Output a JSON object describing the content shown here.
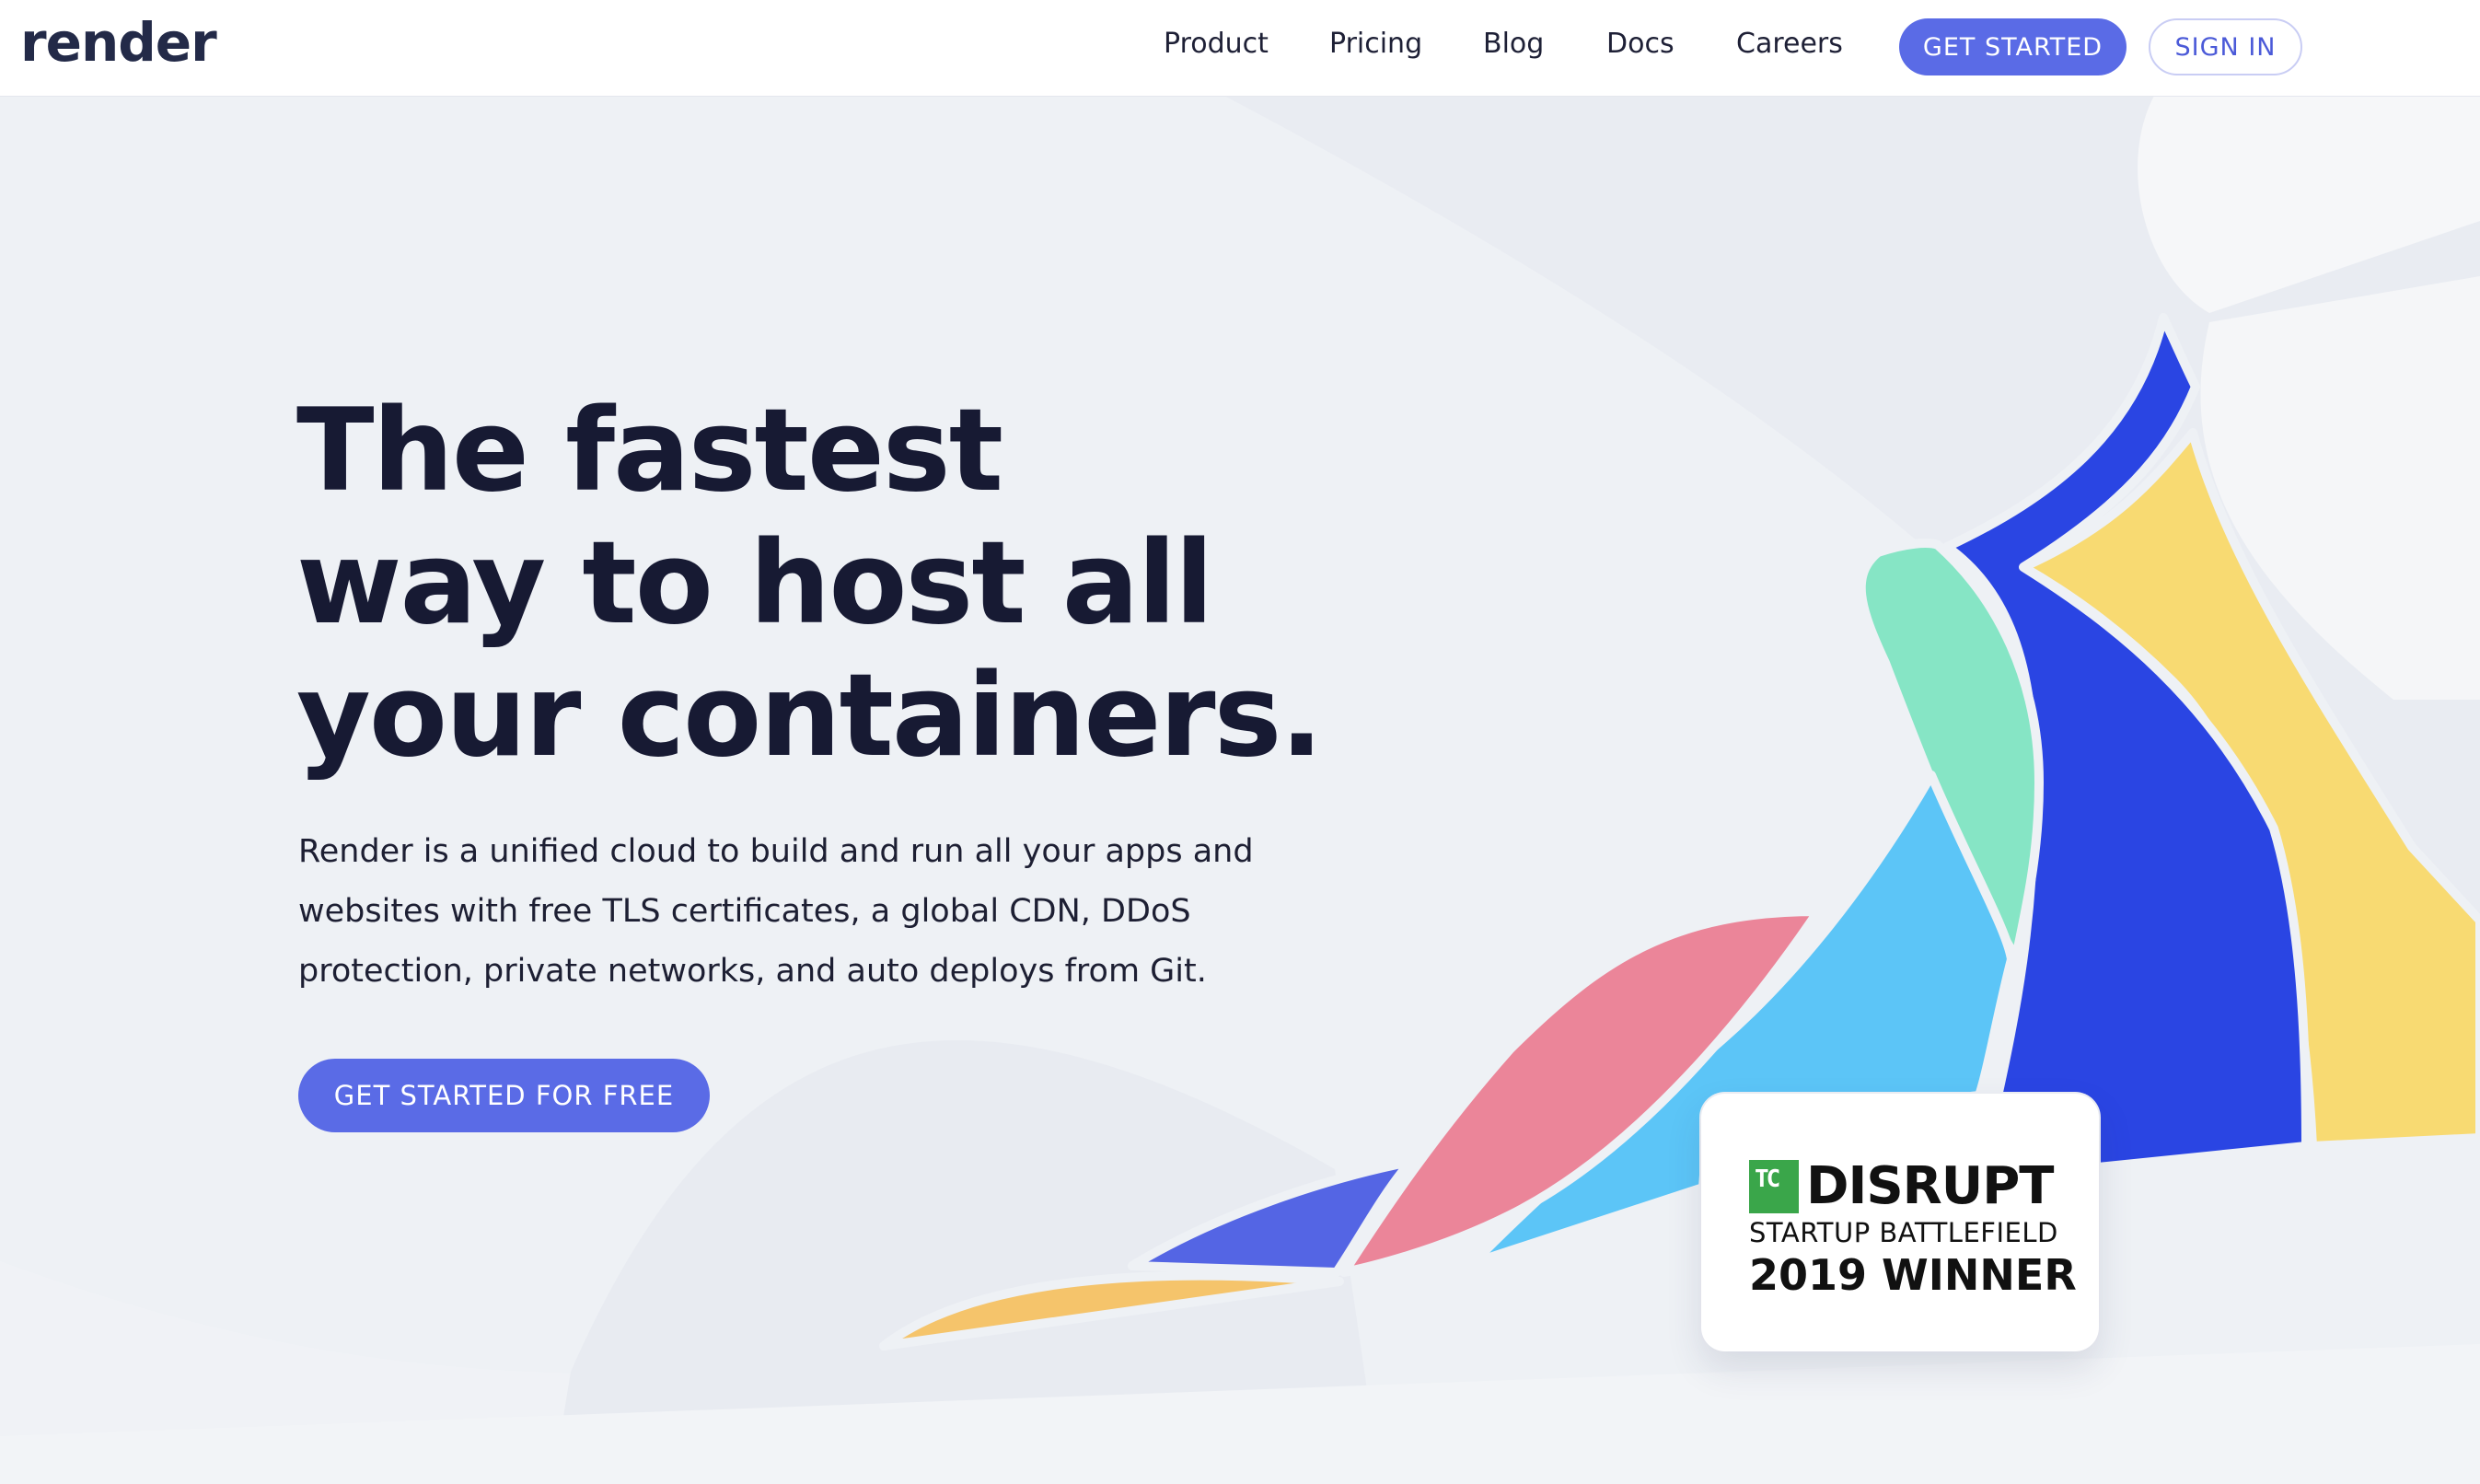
{
  "header": {
    "logo": "render",
    "nav": [
      "Product",
      "Pricing",
      "Blog",
      "Docs",
      "Careers"
    ],
    "get_started": "GET STARTED",
    "sign_in": "SIGN IN"
  },
  "hero": {
    "headline": [
      "The fastest",
      "way to host all",
      "your containers."
    ],
    "subtext": [
      "Render is a unified cloud to build and run all your apps and",
      "websites with free TLS certificates, a global CDN, DDoS",
      "protection, private networks, and auto deploys from Git."
    ],
    "cta": "GET STARTED FOR FREE"
  },
  "badge": {
    "logo_text": "TC",
    "title": "DISRUPT",
    "subtitle": "STARTUP BATTLEFIELD",
    "award": "2019 WINNER"
  },
  "colors": {
    "accent": "#5a6be6",
    "heading": "#171a33",
    "deep_blue": "#2a45e3",
    "sky_blue": "#5cc5f7",
    "mint": "#86e5c5",
    "yellow": "#f8da72",
    "pink": "#eb8599",
    "orange": "#f5c46b",
    "indigo": "#5465e4"
  }
}
